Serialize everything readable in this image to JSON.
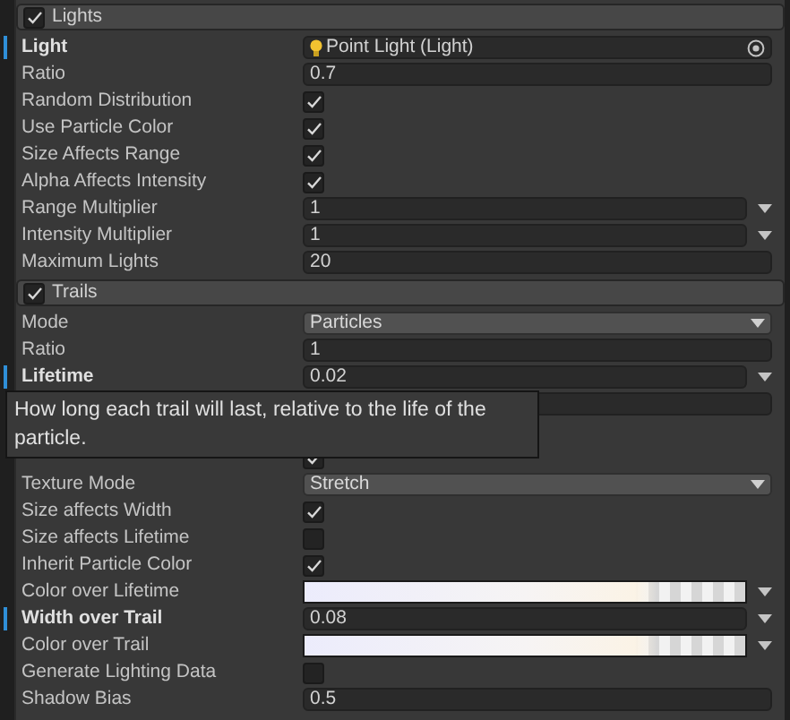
{
  "sections": [
    {
      "title": "Lights",
      "enabled": true,
      "rows": [
        {
          "kind": "object",
          "label": "Light",
          "bold": true,
          "modified": true,
          "value": "Point Light (Light)"
        },
        {
          "kind": "field",
          "label": "Ratio",
          "value": "0.7"
        },
        {
          "kind": "checkbox",
          "label": "Random Distribution",
          "checked": true
        },
        {
          "kind": "checkbox",
          "label": "Use Particle Color",
          "checked": true
        },
        {
          "kind": "checkbox",
          "label": "Size Affects Range",
          "checked": true
        },
        {
          "kind": "checkbox",
          "label": "Alpha Affects Intensity",
          "checked": true
        },
        {
          "kind": "curve",
          "label": "Range Multiplier",
          "value": "1"
        },
        {
          "kind": "curve",
          "label": "Intensity Multiplier",
          "value": "1"
        },
        {
          "kind": "field",
          "label": "Maximum Lights",
          "value": "20"
        }
      ]
    },
    {
      "title": "Trails",
      "enabled": true,
      "rows": [
        {
          "kind": "select",
          "label": "Mode",
          "value": "Particles"
        },
        {
          "kind": "field",
          "label": "Ratio",
          "value": "1"
        },
        {
          "kind": "curve",
          "label": "Lifetime",
          "bold": true,
          "modified": true,
          "value": "0.02"
        },
        {
          "kind": "field"
        },
        {
          "kind": "blank"
        },
        {
          "kind": "checkbox",
          "checked": true
        },
        {
          "kind": "select",
          "label": "Texture Mode",
          "value": "Stretch"
        },
        {
          "kind": "checkbox",
          "label": "Size affects Width",
          "checked": true
        },
        {
          "kind": "checkbox",
          "label": "Size affects Lifetime",
          "checked": false
        },
        {
          "kind": "checkbox",
          "label": "Inherit Particle Color",
          "checked": true
        },
        {
          "kind": "gradient",
          "label": "Color over Lifetime"
        },
        {
          "kind": "curve",
          "label": "Width over Trail",
          "bold": true,
          "modified": true,
          "value": "0.08"
        },
        {
          "kind": "gradient",
          "label": "Color over Trail"
        },
        {
          "kind": "checkbox",
          "label": "Generate Lighting Data",
          "checked": false
        },
        {
          "kind": "field",
          "label": "Shadow Bias",
          "value": "0.5"
        }
      ]
    }
  ],
  "tooltip": {
    "text": "How long each trail will last, relative to the life of the particle."
  }
}
